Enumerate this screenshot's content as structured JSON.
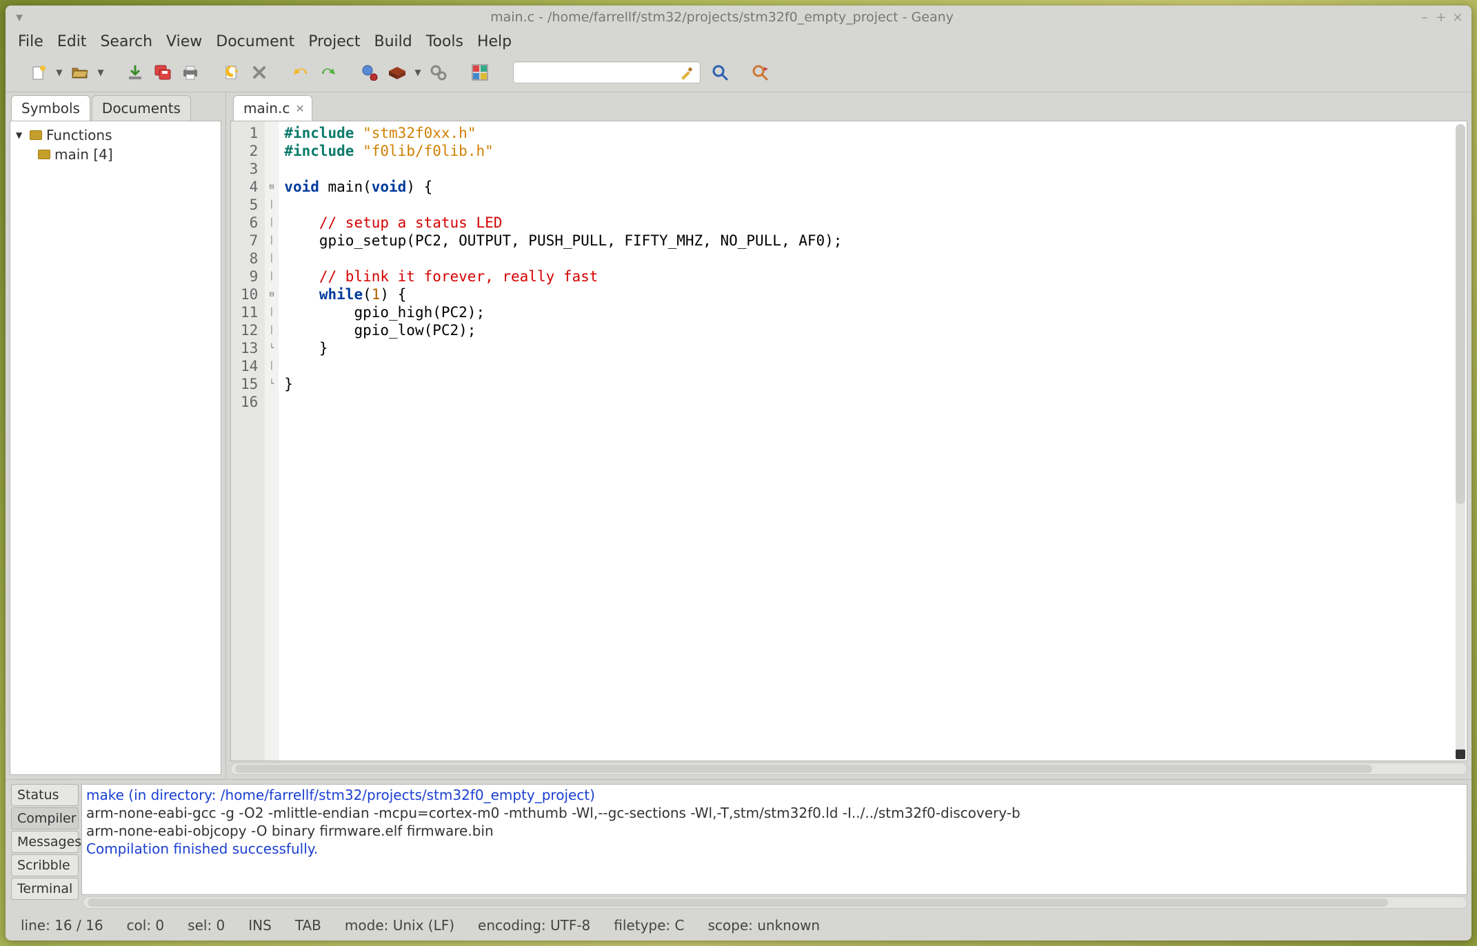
{
  "titlebar": {
    "title": "main.c - /home/farrellf/stm32/projects/stm32f0_empty_project - Geany"
  },
  "menubar": [
    "File",
    "Edit",
    "Search",
    "View",
    "Document",
    "Project",
    "Build",
    "Tools",
    "Help"
  ],
  "sidebar": {
    "tabs": [
      "Symbols",
      "Documents"
    ],
    "active_tab": 0,
    "tree": {
      "root_label": "Functions",
      "item_label": "main [4]"
    }
  },
  "editor": {
    "tab_label": "main.c",
    "lines": [
      {
        "n": "1",
        "fold": " ",
        "html": "<span class=\"kwpp\">#include</span> <span class=\"str\">\"stm32f0xx.h\"</span>"
      },
      {
        "n": "2",
        "fold": " ",
        "html": "<span class=\"kwpp\">#include</span> <span class=\"str\">\"f0lib/f0lib.h\"</span>"
      },
      {
        "n": "3",
        "fold": " ",
        "html": ""
      },
      {
        "n": "4",
        "fold": "⊟",
        "html": "<span class=\"kw\">void</span> main(<span class=\"kw\">void</span>) {"
      },
      {
        "n": "5",
        "fold": "│",
        "html": ""
      },
      {
        "n": "6",
        "fold": "│",
        "html": "    <span class=\"cmt\">// setup a status LED</span>"
      },
      {
        "n": "7",
        "fold": "│",
        "html": "    gpio_setup(PC2, OUTPUT, PUSH_PULL, FIFTY_MHZ, NO_PULL, AF0);"
      },
      {
        "n": "8",
        "fold": "│",
        "html": ""
      },
      {
        "n": "9",
        "fold": "│",
        "html": "    <span class=\"cmt\">// blink it forever, really fast</span>"
      },
      {
        "n": "10",
        "fold": "⊟",
        "html": "    <span class=\"kw\">while</span>(<span class=\"num\">1</span>) {"
      },
      {
        "n": "11",
        "fold": "│",
        "html": "        gpio_high(PC2);"
      },
      {
        "n": "12",
        "fold": "│",
        "html": "        gpio_low(PC2);"
      },
      {
        "n": "13",
        "fold": "└",
        "html": "    }"
      },
      {
        "n": "14",
        "fold": "│",
        "html": ""
      },
      {
        "n": "15",
        "fold": "└",
        "html": "}"
      },
      {
        "n": "16",
        "fold": " ",
        "html": "",
        "current": true
      }
    ]
  },
  "bottom": {
    "tabs": [
      "Status",
      "Compiler",
      "Messages",
      "Scribble",
      "Terminal"
    ],
    "active_tab": 1,
    "lines": [
      {
        "cls": "blue",
        "text": "make (in directory: /home/farrellf/stm32/projects/stm32f0_empty_project)"
      },
      {
        "cls": "",
        "text": "arm-none-eabi-gcc -g -O2 -mlittle-endian -mcpu=cortex-m0   -mthumb  -Wl,--gc-sections -Wl,-T,stm/stm32f0.ld -I../../stm32f0-discovery-b"
      },
      {
        "cls": "",
        "text": "arm-none-eabi-objcopy -O binary firmware.elf firmware.bin"
      },
      {
        "cls": "blue",
        "text": "Compilation finished successfully."
      }
    ]
  },
  "statusbar": {
    "line": "line: 16 / 16",
    "col": "col: 0",
    "sel": "sel: 0",
    "ins": "INS",
    "tab": "TAB",
    "mode": "mode: Unix (LF)",
    "encoding": "encoding: UTF-8",
    "filetype": "filetype: C",
    "scope": "scope: unknown"
  },
  "search": {
    "placeholder": ""
  }
}
